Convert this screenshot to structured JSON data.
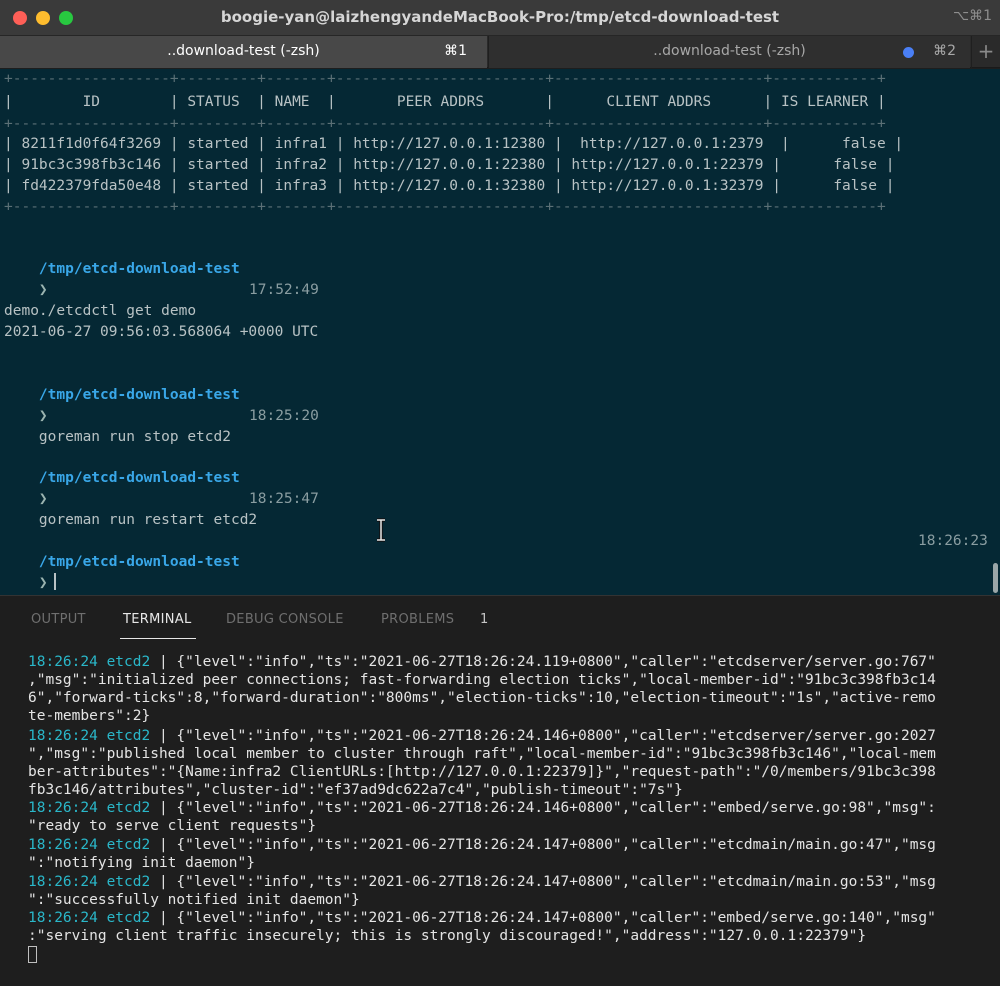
{
  "window": {
    "title": "boogie-yan@laizhengyandeMacBook-Pro:/tmp/etcd-download-test",
    "shortcut": "⌥⌘1"
  },
  "tabs": [
    {
      "label": "..download-test (-zsh)",
      "shortcut": "⌘1"
    },
    {
      "label": "..download-test (-zsh)",
      "shortcut": "⌘2"
    }
  ],
  "tab_add": "+",
  "terminal": {
    "table_border": "+------------------+---------+-------+------------------------+------------------------+------------+",
    "table_header": "|        ID        | STATUS  | NAME  |       PEER ADDRS       |      CLIENT ADDRS      | IS LEARNER |",
    "table_rows": [
      "| 8211f1d0f64f3269 | started | infra1 | http://127.0.0.1:12380 |  http://127.0.0.1:2379  |      false |",
      "| 91bc3c398fb3c146 | started | infra2 | http://127.0.0.1:22380 | http://127.0.0.1:22379 |      false |",
      "| fd422379fda50e48 | started | infra3 | http://127.0.0.1:32380 | http://127.0.0.1:32379 |      false |"
    ],
    "prompt_path": "/tmp/etcd-download-test",
    "prompt_arrow": "❯",
    "commands": [
      {
        "cmd": "./etcdctl get demo",
        "time": "17:52:49"
      },
      {
        "cmd": "goreman run stop etcd2",
        "time": "18:25:20"
      },
      {
        "cmd": "goreman run restart etcd2",
        "time": "18:25:47"
      }
    ],
    "output_lines": [
      "demo",
      "2021-06-27 09:56:03.568064 +0000 UTC"
    ],
    "current_time": "18:26:23"
  },
  "panel": {
    "tabs": [
      "OUTPUT",
      "TERMINAL",
      "DEBUG CONSOLE",
      "PROBLEMS"
    ],
    "active_tab": "TERMINAL",
    "problems_count": "1"
  },
  "log": {
    "lines": [
      {
        "ts": "18:26:24 etcd2",
        "text": " | {\"level\":\"info\",\"ts\":\"2021-06-27T18:26:24.119+0800\",\"caller\":\"etcdserver/server.go:767\""
      },
      {
        "ts": "",
        "text": ",\"msg\":\"initialized peer connections; fast-forwarding election ticks\",\"local-member-id\":\"91bc3c398fb3c14"
      },
      {
        "ts": "",
        "text": "6\",\"forward-ticks\":8,\"forward-duration\":\"800ms\",\"election-ticks\":10,\"election-timeout\":\"1s\",\"active-remo"
      },
      {
        "ts": "",
        "text": "te-members\":2}"
      },
      {
        "ts": "18:26:24 etcd2",
        "text": " | {\"level\":\"info\",\"ts\":\"2021-06-27T18:26:24.146+0800\",\"caller\":\"etcdserver/server.go:2027"
      },
      {
        "ts": "",
        "text": "\",\"msg\":\"published local member to cluster through raft\",\"local-member-id\":\"91bc3c398fb3c146\",\"local-mem"
      },
      {
        "ts": "",
        "text": "ber-attributes\":\"{Name:infra2 ClientURLs:[http://127.0.0.1:22379]}\",\"request-path\":\"/0/members/91bc3c398"
      },
      {
        "ts": "",
        "text": "fb3c146/attributes\",\"cluster-id\":\"ef37ad9dc622a7c4\",\"publish-timeout\":\"7s\"}"
      },
      {
        "ts": "18:26:24 etcd2",
        "text": " | {\"level\":\"info\",\"ts\":\"2021-06-27T18:26:24.146+0800\",\"caller\":\"embed/serve.go:98\",\"msg\":"
      },
      {
        "ts": "",
        "text": "\"ready to serve client requests\"}"
      },
      {
        "ts": "18:26:24 etcd2",
        "text": " | {\"level\":\"info\",\"ts\":\"2021-06-27T18:26:24.147+0800\",\"caller\":\"etcdmain/main.go:47\",\"msg"
      },
      {
        "ts": "",
        "text": "\":\"notifying init daemon\"}"
      },
      {
        "ts": "18:26:24 etcd2",
        "text": " | {\"level\":\"info\",\"ts\":\"2021-06-27T18:26:24.147+0800\",\"caller\":\"etcdmain/main.go:53\",\"msg"
      },
      {
        "ts": "",
        "text": "\":\"successfully notified init daemon\"}"
      },
      {
        "ts": "18:26:24 etcd2",
        "text": " | {\"level\":\"info\",\"ts\":\"2021-06-27T18:26:24.147+0800\",\"caller\":\"embed/serve.go:140\",\"msg\""
      },
      {
        "ts": "",
        "text": ":\"serving client traffic insecurely; this is strongly discouraged!\",\"address\":\"127.0.0.1:22379\"}"
      }
    ]
  }
}
